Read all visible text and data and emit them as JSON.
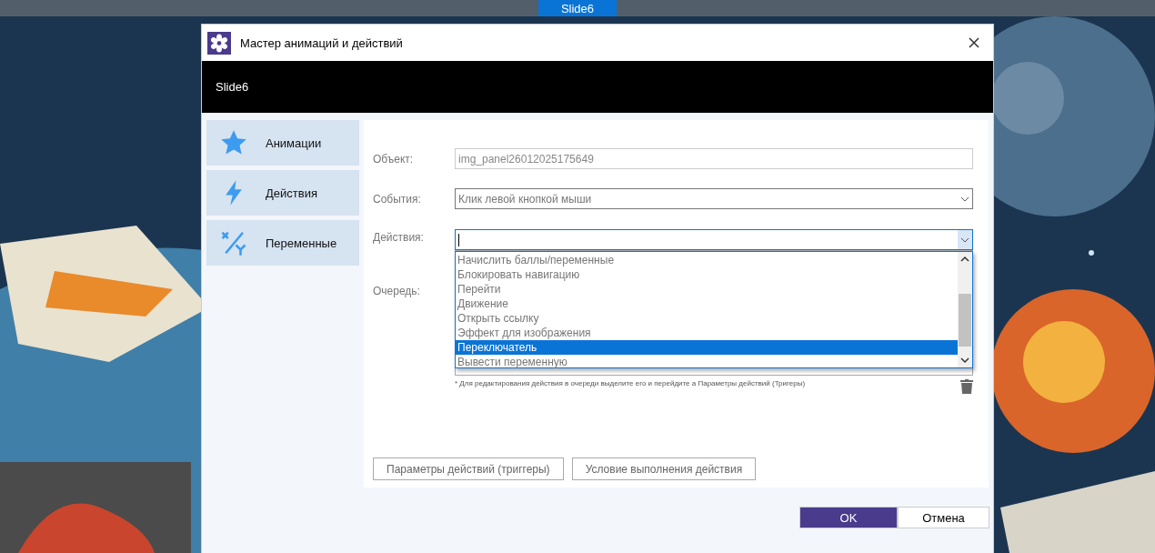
{
  "top_bar": {
    "tabs": [
      {
        "label": "Slide6",
        "selected": true
      }
    ]
  },
  "dialog": {
    "title": "Мастер анимаций и действий",
    "header": "Slide6",
    "sidebar": [
      {
        "label": "Анимации",
        "kind": "star",
        "selected": false
      },
      {
        "label": "Действия",
        "kind": "bolt",
        "selected": false
      },
      {
        "label": "Переменные",
        "kind": "variable",
        "selected": false
      }
    ],
    "object": {
      "label": "Объект:",
      "value": "img_panel26012025175649",
      "disabled": true
    },
    "event": {
      "label": "События:",
      "value": "Клик левой кнопкой мыши"
    },
    "action": {
      "label": "Действия:",
      "expanded": true,
      "options": [
        {
          "label": "Начислить баллы/переменные",
          "selected": false
        },
        {
          "label": "Блокировать навигацию",
          "selected": false
        },
        {
          "label": "Перейти",
          "selected": false
        },
        {
          "label": "Движение",
          "selected": false
        },
        {
          "label": "Открыть ссылку",
          "selected": false
        },
        {
          "label": "Эффект для изображения",
          "selected": false
        },
        {
          "label": "Переключатель",
          "selected": true
        },
        {
          "label": "Вывести переменную",
          "selected": false
        }
      ]
    },
    "queue": {
      "label": "Очередь:",
      "note": "* Для редактирования действия в очереди выделите его и перейдите а Параметры действий (Тригеры)"
    },
    "panel_buttons": [
      "Параметры действий (триггеры)",
      "Условие выполнения действия"
    ],
    "footer_buttons": [
      {
        "label": "OK",
        "kind": "primary"
      },
      {
        "label": "Отмена",
        "kind": "secondary"
      }
    ]
  }
}
